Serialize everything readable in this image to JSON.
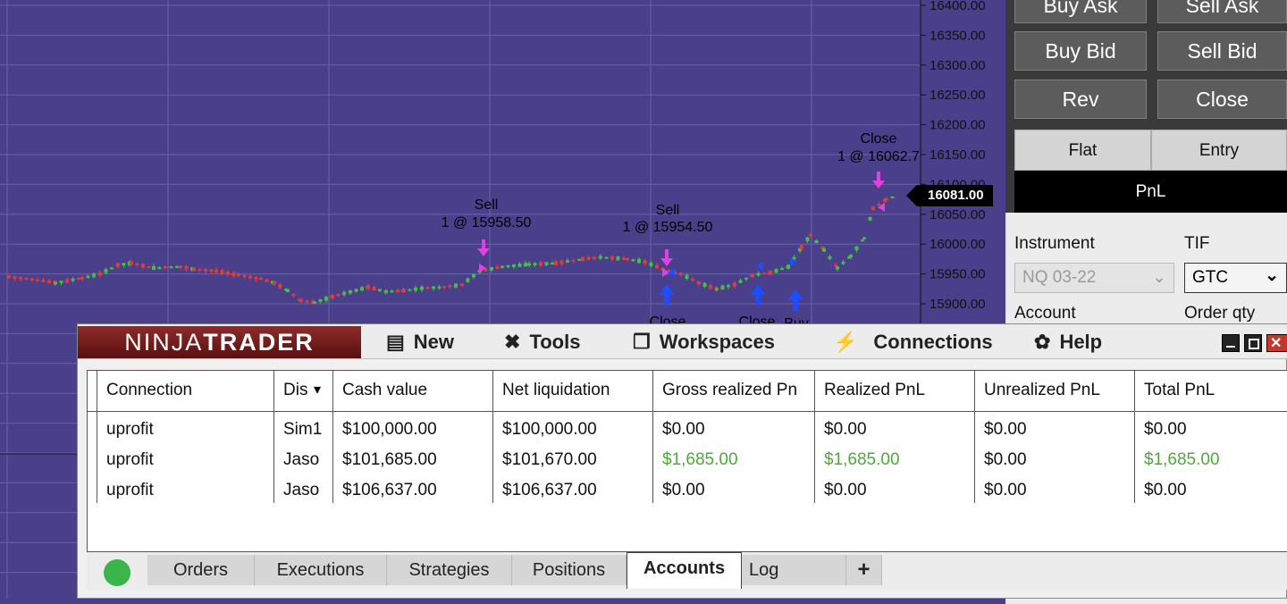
{
  "chart": {
    "price_axis": [
      "16400.00",
      "16350.00",
      "16300.00",
      "16250.00",
      "16200.00",
      "16150.00",
      "16100.00",
      "16050.00",
      "16000.00",
      "15950.00",
      "15900.00"
    ],
    "last_price": "16081.00",
    "colors": {
      "background": "#4a3f8a",
      "grid": "#6a63a8",
      "up": "#43c043",
      "down": "#e23a3a",
      "marker": "#e040e0",
      "buy_marker": "#1e4cff"
    },
    "annotations": [
      {
        "line1": "Sell",
        "line2": "1 @ 15958.50"
      },
      {
        "line1": "Sell",
        "line2": "1 @ 15954.50"
      },
      {
        "line1": "Close",
        "line2": "1 @ 16062.7"
      },
      {
        "line1": "Close",
        "line2": ""
      },
      {
        "line1": "Close",
        "line2": ""
      },
      {
        "line1": "Buy",
        "line2": ""
      }
    ]
  },
  "trade_panel": {
    "buttons": {
      "buy_ask": "Buy Ask",
      "sell_ask": "Sell Ask",
      "buy_bid": "Buy Bid",
      "sell_bid": "Sell Bid",
      "rev": "Rev",
      "close": "Close"
    },
    "position": {
      "flat": "Flat",
      "entry": "Entry",
      "pnl": "PnL"
    },
    "instrument_label": "Instrument",
    "instrument_value": "NQ 03-22",
    "tif_label": "TIF",
    "tif_value": "GTC",
    "account_label": "Account",
    "order_qty_label": "Order qty"
  },
  "control_center": {
    "logo": {
      "part1": "NINJA",
      "part2": "TRADER"
    },
    "menu": {
      "new": "New",
      "tools": "Tools",
      "workspaces": "Workspaces",
      "connections": "Connections",
      "help": "Help"
    },
    "accounts_table": {
      "headers": [
        "Connection",
        "Dis",
        "Cash value",
        "Net liquidation",
        "Gross realized Pn",
        "Realized PnL",
        "Unrealized PnL",
        "Total PnL"
      ],
      "rows": [
        [
          "uprofit",
          "Sim1",
          "$100,000.00",
          "$100,000.00",
          "$0.00",
          "$0.00",
          "$0.00",
          "$0.00"
        ],
        [
          "uprofit",
          "Jaso",
          "$101,685.00",
          "$101,670.00",
          "$1,685.00",
          "$1,685.00",
          "$0.00",
          "$1,685.00"
        ],
        [
          "uprofit",
          "Jaso",
          "$106,637.00",
          "$106,637.00",
          "$0.00",
          "$0.00",
          "$0.00",
          "$0.00"
        ]
      ],
      "positive_color": "#4caa39"
    },
    "tabs": {
      "orders": "Orders",
      "executions": "Executions",
      "strategies": "Strategies",
      "positions": "Positions",
      "accounts": "Accounts",
      "log": "Log",
      "add": "+"
    }
  }
}
